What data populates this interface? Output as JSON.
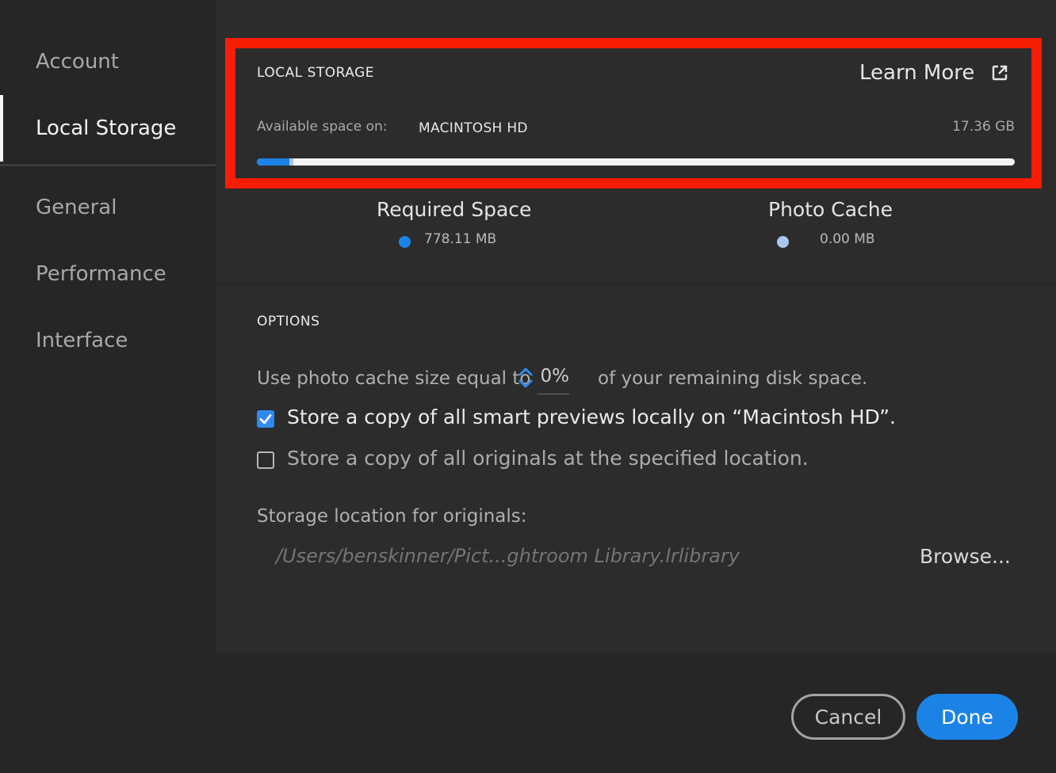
{
  "sidebar": {
    "items": [
      {
        "label": "Account",
        "active": false
      },
      {
        "label": "Local Storage",
        "active": true
      },
      {
        "label": "General",
        "active": false
      },
      {
        "label": "Performance",
        "active": false
      },
      {
        "label": "Interface",
        "active": false
      }
    ]
  },
  "local_storage": {
    "title": "LOCAL STORAGE",
    "learn_more": "Learn More",
    "learn_more_icon": "external-link-icon",
    "available_label": "Available space on:",
    "disk_name": "MACINTOSH HD",
    "disk_free": "17.36 GB",
    "usage_bar": {
      "required_fraction": 0.043,
      "cache_fraction": 0.005
    },
    "legend": {
      "required": {
        "label": "Required Space",
        "value": "778.11 MB",
        "color": "#1c84e8"
      },
      "cache": {
        "label": "Photo Cache",
        "value": "0.00 MB",
        "color": "#a9c7ea"
      }
    },
    "highlight_color": "#f71d05"
  },
  "options": {
    "title": "OPTIONS",
    "cache_prefix": "Use photo cache size equal to",
    "cache_percent": "0%",
    "cache_suffix": "of your remaining disk space.",
    "smart_previews": {
      "label": "Store a copy of all smart previews locally on “Macintosh HD”.",
      "checked": true
    },
    "originals": {
      "label": "Store a copy of all originals at the specified location.",
      "checked": false
    },
    "storage_location_label": "Storage location for originals:",
    "storage_path": "/Users/benskinner/Pict...ghtroom Library.lrlibrary",
    "browse_label": "Browse..."
  },
  "footer": {
    "cancel_label": "Cancel",
    "done_label": "Done",
    "accent": "#1b83e6"
  }
}
